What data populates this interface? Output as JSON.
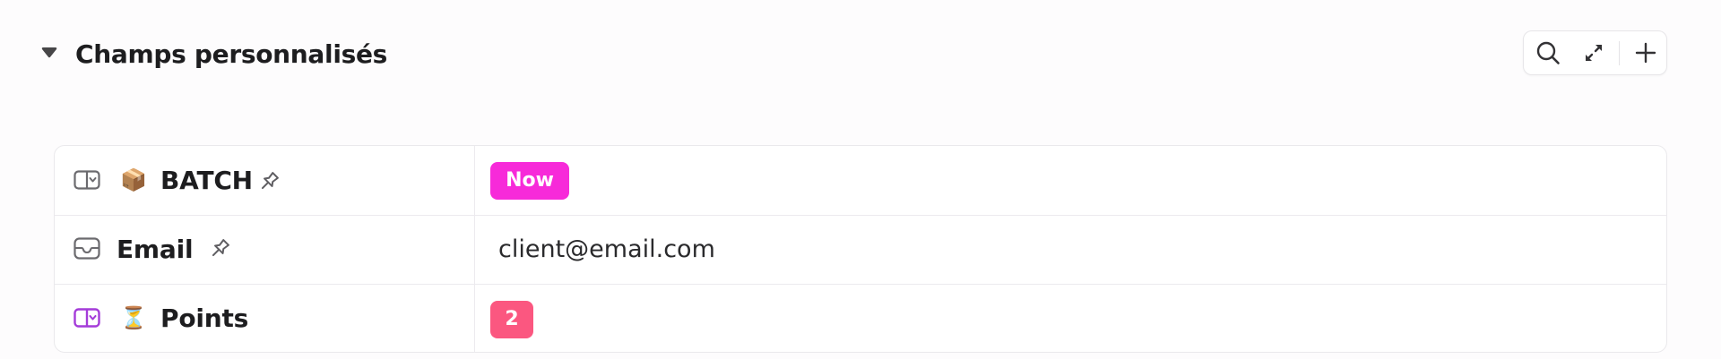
{
  "section": {
    "title": "Champs personnalisés",
    "toggle_icon": "caret-down-icon",
    "toolbar": {
      "search_icon": "search-icon",
      "expand_icon": "expand-icon",
      "add_icon": "plus-icon"
    }
  },
  "fields": [
    {
      "type_icon": "dropdown-field-icon",
      "emoji": "📦",
      "name": "BATCH",
      "pinned_icon": "pin-icon",
      "value": "Now",
      "value_kind": "tag",
      "value_color": "#f72ad9"
    },
    {
      "type_icon": "email-field-icon",
      "name": "Email",
      "pinned_icon": "pin-icon",
      "value": "client@email.com",
      "value_kind": "text"
    },
    {
      "type_icon": "dropdown-field-icon",
      "type_icon_color": "#a43bd9",
      "emoji": "⏳",
      "name": "Points",
      "value": "2",
      "value_kind": "tag",
      "value_color": "#fb5780"
    }
  ]
}
